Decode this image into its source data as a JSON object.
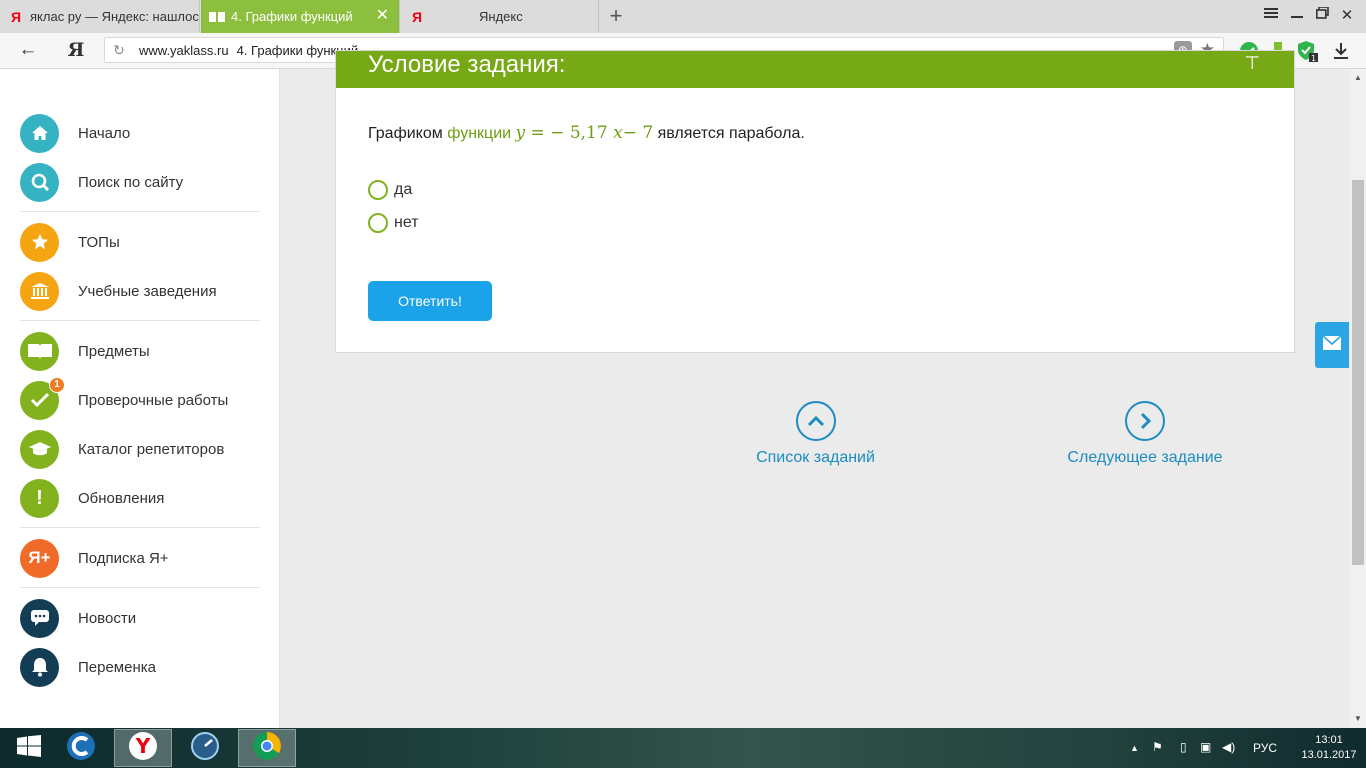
{
  "browser": {
    "tabs": [
      {
        "title": "яклас ру — Яндекс: нашлос",
        "favicon": "Я",
        "active": false
      },
      {
        "title": "4. Графики функций",
        "favicon": "book-icon",
        "active": true
      },
      {
        "title": "Яндекс",
        "favicon": "Я",
        "active": false
      }
    ],
    "new_tab_icon": "plus-icon",
    "address": {
      "domain": "www.yaklass.ru",
      "page_title": "4. Графики функций"
    },
    "yandex_button": "Я"
  },
  "sidebar": {
    "items": [
      {
        "label": "Начало",
        "icon": "home-icon",
        "color": "#36b3c3"
      },
      {
        "label": "Поиск по сайту",
        "icon": "search-icon",
        "color": "#36b3c3"
      },
      {
        "label": "ТОПы",
        "icon": "star-icon",
        "color": "#f5a412"
      },
      {
        "label": "Учебные заведения",
        "icon": "school-building-icon",
        "color": "#f5a412"
      },
      {
        "label": "Предметы",
        "icon": "open-book-icon",
        "color": "#82b21e"
      },
      {
        "label": "Проверочные работы",
        "icon": "checkmark-icon",
        "color": "#82b21e",
        "badge": "1"
      },
      {
        "label": "Каталог репетиторов",
        "icon": "graduation-cap-icon",
        "color": "#82b21e"
      },
      {
        "label": "Обновления",
        "icon": "exclamation-icon",
        "color": "#82b21e"
      },
      {
        "label": "Подписка Я+",
        "icon": "ya-plus-icon",
        "color": "#f06a28",
        "icon_text": "Я+"
      },
      {
        "label": "Новости",
        "icon": "chat-bubble-icon",
        "color": "#123d55"
      },
      {
        "label": "Переменка",
        "icon": "bell-icon",
        "color": "#123d55"
      }
    ]
  },
  "task": {
    "header_title": "Условие задания:",
    "question": {
      "prefix": "Графиком",
      "keyword": "функции",
      "formula_y": "y",
      "formula_eq": " = − 5,17 ",
      "formula_x": "x",
      "formula_tail": "− 7",
      "suffix": "является парабола."
    },
    "options": [
      "да",
      "нет"
    ],
    "submit_label": "Ответить!"
  },
  "navigation": {
    "list_label": "Список заданий",
    "next_label": "Следующее задание"
  },
  "taskbar": {
    "language": "РУС",
    "time": "13:01",
    "date": "13.01.2017"
  }
}
